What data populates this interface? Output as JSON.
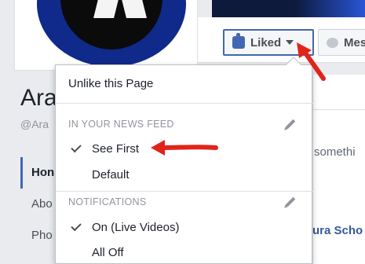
{
  "profile": {
    "name_partial": "Ara",
    "handle_partial": "@Ara",
    "nav": [
      {
        "label": "Hon",
        "active": true
      },
      {
        "label": "Abo",
        "active": false
      },
      {
        "label": "Pho",
        "active": false
      }
    ]
  },
  "actions": {
    "liked_label": "Liked",
    "message_label": "Mes"
  },
  "right_content": {
    "post_prompt": "somethi",
    "school_link": "ura Scho"
  },
  "dropdown": {
    "unlike_label": "Unlike this Page",
    "news_feed_header": "IN YOUR NEWS FEED",
    "see_first_label": "See First",
    "default_label": "Default",
    "notifications_header": "NOTIFICATIONS",
    "live_videos_label": "On (Live Videos)",
    "all_off_label": "All Off"
  },
  "colors": {
    "accent": "#4267b2",
    "annotation": "#e0241c"
  },
  "icons": [
    "thumbs-up-icon",
    "caret-down-icon",
    "messenger-icon",
    "check-icon",
    "pencil-icon"
  ]
}
